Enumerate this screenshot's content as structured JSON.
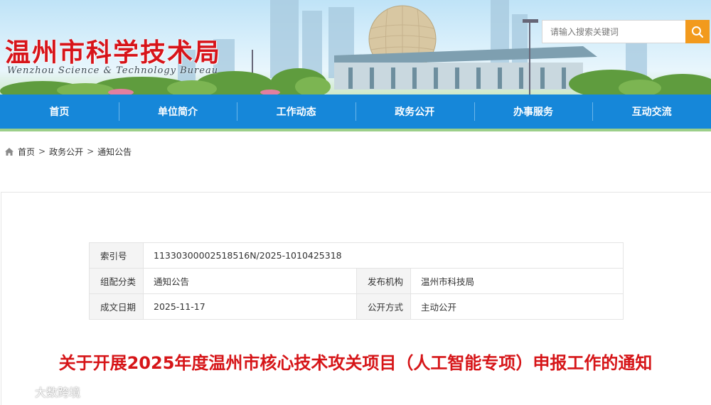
{
  "header": {
    "site_title": "温州市科学技术局",
    "site_subtitle": "Wenzhou Science & Technology Bureau",
    "search": {
      "placeholder": "请输入搜索关键词",
      "button_icon": "search-icon"
    }
  },
  "nav": {
    "items": [
      {
        "label": "首页"
      },
      {
        "label": "单位简介"
      },
      {
        "label": "工作动态"
      },
      {
        "label": "政务公开"
      },
      {
        "label": "办事服务"
      },
      {
        "label": "互动交流"
      }
    ]
  },
  "breadcrumb": {
    "icon": "home-icon",
    "separator": ">",
    "items": [
      {
        "label": "首页"
      },
      {
        "label": "政务公开"
      },
      {
        "label": "通知公告"
      }
    ]
  },
  "doc_info": {
    "index_label": "索引号",
    "index_value": "11330300002518516N/2025-1010425318",
    "category_label": "组配分类",
    "category_value": "通知公告",
    "publisher_label": "发布机构",
    "publisher_value": "温州市科技局",
    "date_label": "成文日期",
    "date_value": "2025-11-17",
    "disclosure_label": "公开方式",
    "disclosure_value": "主动公开"
  },
  "article": {
    "title": "关于开展2025年度温州市核心技术攻关项目（人工智能专项）申报工作的通知"
  },
  "watermark": {
    "text": "大数跨境"
  },
  "colors": {
    "nav_blue": "#1687d9",
    "title_red": "#d61518",
    "search_orange": "#f29a1d",
    "accent_green": "#9ccf8a"
  }
}
